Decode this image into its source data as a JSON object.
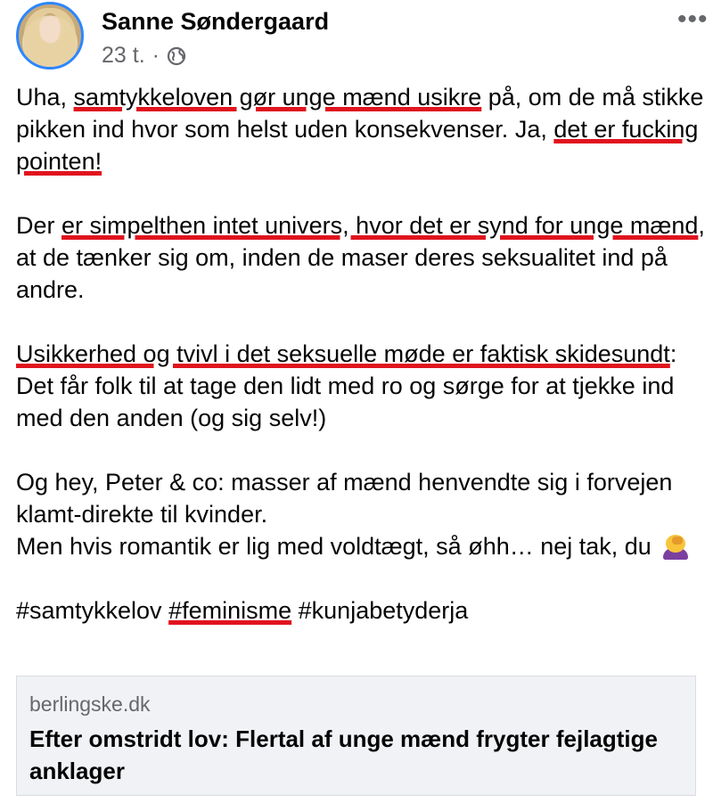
{
  "post": {
    "author": "Sanne Søndergaard",
    "time": "23 t.",
    "dot": "·",
    "audience_icon": "globe-icon",
    "more_icon": "•••"
  },
  "text": {
    "p1a": "Uha, ",
    "p1b": "samtykkeloven gør unge mænd usikre",
    "p1c": " på, om de må stikke pikken ind hvor som helst uden konsekvenser. Ja, ",
    "p1d": "det er fucking pointen!",
    "p2a": "Der ",
    "p2b": "er simpelthen intet univers, hvor det er synd for unge mænd",
    "p2c": ", at de tænker sig om, inden de maser deres seksualitet ind på andre.",
    "p3a": "Usikkerhed og tvivl i det seksuelle møde er faktisk skidesundt",
    "p3b": ": Det får folk til at tage den lidt med ro og sørge for at tjekke ind med den anden (og sig selv!)",
    "p4a": "Og hey, Peter & co: masser af mænd henvendte sig i forvejen klamt-direkte til kvinder.",
    "p4b": "Men hvis romantik er lig med voldtægt, så øhh… nej tak, du",
    "emoji": "facepalm-woman-emoji",
    "tag1": "#samtykkelov",
    "tag2": "#feminisme",
    "tag3": "#kunjabetyderja"
  },
  "link": {
    "domain": "berlingske.dk",
    "title": "Efter omstridt lov: Flertal af unge mænd frygter fejlagtige anklager"
  },
  "colors": {
    "underline": "#e0141e",
    "avatar_ring": "#2d86ff",
    "meta": "#65676b"
  }
}
